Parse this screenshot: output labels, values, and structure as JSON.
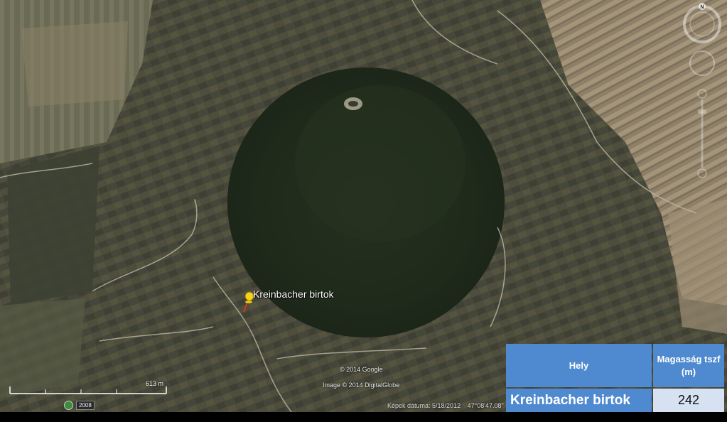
{
  "map": {
    "placemark": {
      "label": "Kreinbacher birtok",
      "icon": "yellow-pushpin-icon"
    },
    "copyright": "© 2014 Google",
    "imagery_credit": "Image © 2014 DigitalGlobe",
    "scale": {
      "label": "613 m"
    },
    "historical_imagery": {
      "year": "2008",
      "icon": "historical-imagery-clock-icon"
    },
    "status": {
      "imagery_date": "Képek dátuma: 5/18/2012",
      "latitude": "47°08'47.08\""
    },
    "navigation": {
      "north_label": "N",
      "icons": [
        "compass-ring-icon",
        "look-joystick-icon",
        "move-joystick-icon",
        "zoom-slider-icon"
      ]
    }
  },
  "info_table": {
    "headers": {
      "place": "Hely",
      "altitude": "Magasság tszf (m)"
    },
    "row": {
      "place": "Kreinbacher birtok",
      "altitude": "242"
    }
  },
  "colors": {
    "table_header": "#4f8ad0",
    "table_value_cell": "#d6e2f2",
    "forest": "#1f2a1b",
    "farmland": "#4b4a3c",
    "pushpin": "#f2d21c"
  }
}
